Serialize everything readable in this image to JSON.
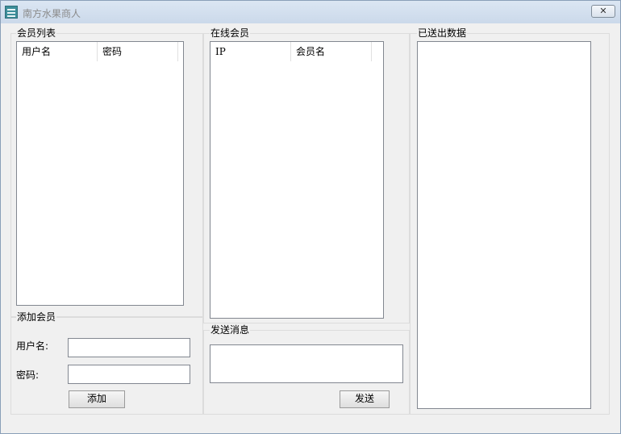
{
  "window": {
    "title": "南方水果商人",
    "icon": "app-icon",
    "close_label": "✕"
  },
  "member_list": {
    "title": "会员列表",
    "columns": [
      "用户名",
      "密码"
    ],
    "rows": []
  },
  "online_members": {
    "title": "在线会员",
    "columns": [
      "IP",
      "会员名"
    ],
    "rows": []
  },
  "sent_data": {
    "title": "已送出数据",
    "value": ""
  },
  "add_member": {
    "title": "添加会员",
    "username_label": "用户名:",
    "username_value": "",
    "password_label": "密码:",
    "password_value": "",
    "add_button": "添加"
  },
  "send_message": {
    "title": "发送消息",
    "message_value": "",
    "send_button": "发送"
  }
}
